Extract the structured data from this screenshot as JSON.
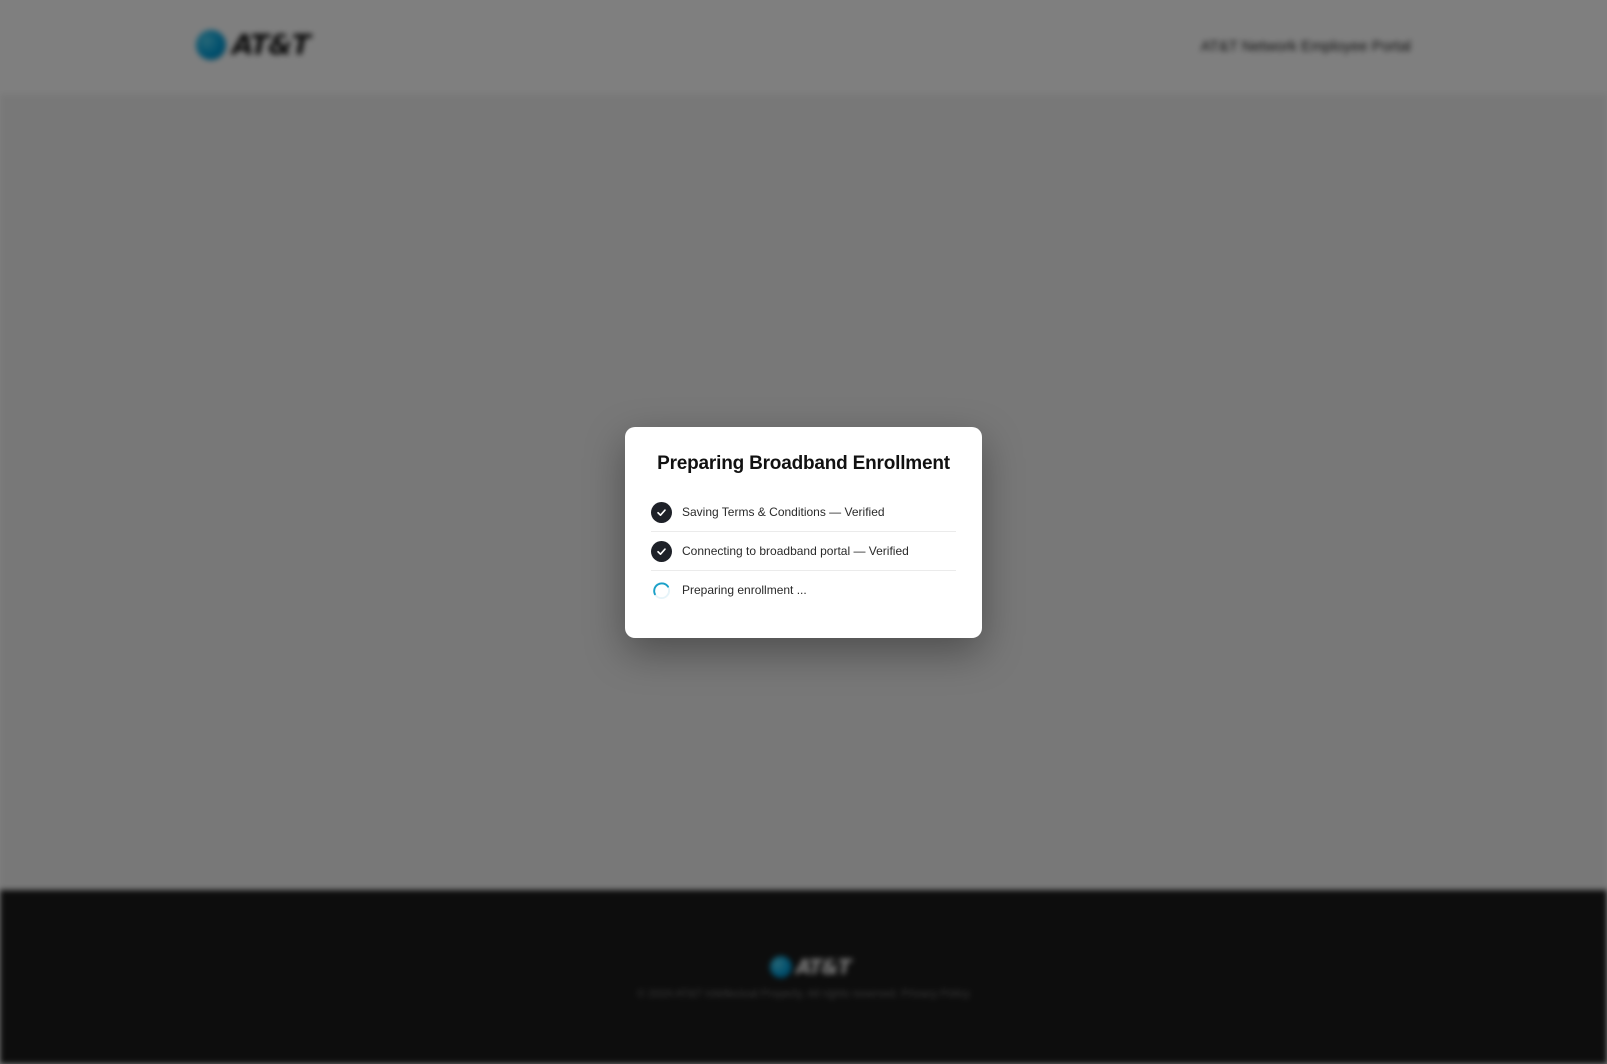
{
  "header": {
    "brand": "AT&T",
    "portal_link": "AT&T Network Employee Portal"
  },
  "footer": {
    "brand": "AT&T",
    "copyright": "© 2024 AT&T Intellectual Property. All rights reserved. Privacy Policy"
  },
  "modal": {
    "title": "Preparing Broadband Enrollment",
    "steps": [
      {
        "label": "Saving Terms & Conditions — Verified",
        "status": "complete",
        "icon": "check-icon"
      },
      {
        "label": "Connecting to broadband portal — Verified",
        "status": "complete",
        "icon": "check-icon"
      },
      {
        "label": "Preparing enrollment ...",
        "status": "in-progress",
        "icon": "spinner-icon"
      }
    ]
  },
  "colors": {
    "brand_blue": "#009fdb",
    "check_bg": "#1e2128",
    "spinner": "#1aa0c8",
    "overlay": "rgba(0,0,0,0.5)"
  }
}
